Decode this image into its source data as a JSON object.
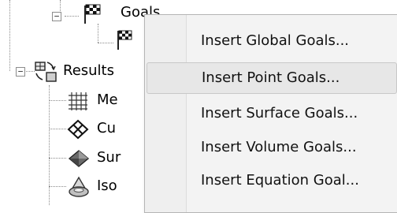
{
  "tree": {
    "goals_label": "Goals",
    "results_label": "Results",
    "mesh_label": "Me",
    "cut_label": "Cu",
    "surface_label": "Sur",
    "iso_label": "Iso"
  },
  "context_menu": {
    "items": [
      {
        "label": "Insert Global Goals..."
      },
      {
        "label": "Insert Point Goals...",
        "highlighted": true
      },
      {
        "label": "Insert Surface Goals..."
      },
      {
        "label": "Insert Volume Goals..."
      },
      {
        "label": "Insert Equation Goal..."
      }
    ]
  },
  "icons": {
    "goals": "checkered-flag-icon",
    "goal_child": "checkered-flag-icon",
    "results": "results-plots-icon",
    "mesh": "mesh-grid-icon",
    "cut": "cut-plot-icon",
    "surface": "surface-plot-icon",
    "iso": "isosurface-icon"
  }
}
